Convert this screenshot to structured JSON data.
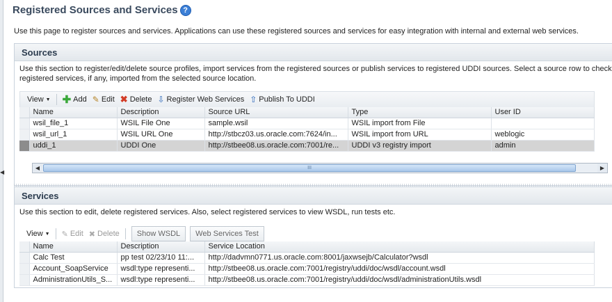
{
  "page": {
    "title": "Registered Sources and Services",
    "help_icon": "question-help-icon",
    "intro": "Use this page to register sources and services. Applications can use these registered sources and services for easy integration with internal and external web services."
  },
  "sources": {
    "header": "Sources",
    "description_line1": "Use this section to register/edit/delete source profiles, import services from the registered sources or publish services to registered UDDI sources. Select a source row to check ou",
    "description_line2": "registered services, if any, imported from the selected source location.",
    "toolbar": {
      "view": "View",
      "add": "Add",
      "edit": "Edit",
      "delete": "Delete",
      "register": "Register Web Services",
      "publish": "Publish To UDDI"
    },
    "columns": [
      "Name",
      "Description",
      "Source URL",
      "Type",
      "User ID"
    ],
    "rows": [
      [
        "wsil_file_1",
        "WSIL File One",
        "sample.wsil",
        "WSIL import from File",
        ""
      ],
      [
        "wsil_url_1",
        "WSIL URL One",
        "http://stbcz03.us.oracle.com:7624/in...",
        "WSIL import from URL",
        "weblogic"
      ],
      [
        "uddi_1",
        "UDDI One",
        "http://stbee08.us.oracle.com:7001/re...",
        "UDDI v3 registry import",
        "admin"
      ]
    ],
    "selected_row": 2,
    "scroll_grip": "III"
  },
  "services": {
    "header": "Services",
    "description": "Use this section to edit, delete registered services. Also, select registered services to view WSDL, run tests etc.",
    "toolbar": {
      "view": "View",
      "edit": "Edit",
      "delete": "Delete",
      "show_wsdl": "Show WSDL",
      "ws_test": "Web Services Test"
    },
    "columns": [
      "Name",
      "Description",
      "Service Location"
    ],
    "rows": [
      [
        "Calc Test",
        "pp test 02/23/10 11:...",
        "http://dadvmn0771.us.oracle.com:8001/jaxwsejb/Calculator?wsdl"
      ],
      [
        "Account_SoapService",
        "wsdl:type representi...",
        "http://stbee08.us.oracle.com:7001/registry/uddi/doc/wsdl/account.wsdl"
      ],
      [
        "AdministrationUtils_S...",
        "wsdl:type representi...",
        "http://stbee08.us.oracle.com:7001/registry/uddi/doc/wsdl/administrationUtils.wsdl"
      ]
    ]
  }
}
